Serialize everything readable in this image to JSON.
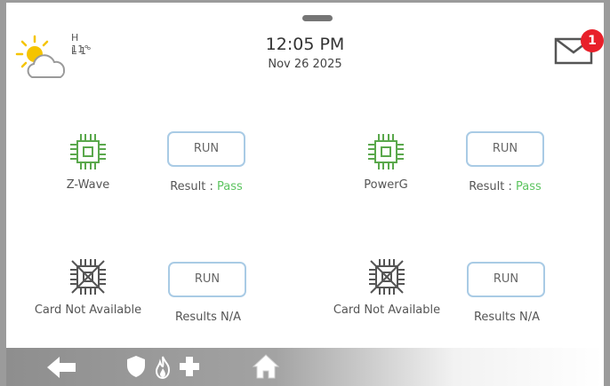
{
  "header": {
    "weather": {
      "high": "H 11°",
      "low": "L 1°",
      "icon": "partly-sunny-icon"
    },
    "time": "12:05 PM",
    "date": "Nov 26 2025",
    "messages": {
      "icon": "envelope-icon",
      "unread_count": "1"
    }
  },
  "modules": [
    {
      "name": "Z-Wave",
      "status": "available",
      "run_label": "RUN",
      "result_prefix": "Result : ",
      "result_value": "Pass"
    },
    {
      "name": "PowerG",
      "status": "available",
      "run_label": "RUN",
      "result_prefix": "Result : ",
      "result_value": "Pass"
    },
    {
      "name": "Card Not Available",
      "status": "unavailable",
      "run_label": "RUN",
      "result_text": "Results N/A"
    },
    {
      "name": "Card Not Available",
      "status": "unavailable",
      "run_label": "RUN",
      "result_text": "Results N/A"
    }
  ],
  "colors": {
    "chip_ok": "#5aa84c",
    "chip_na": "#555555",
    "pass": "#5cc45f",
    "run_border": "#a9cbe5",
    "badge": "#e8202a"
  },
  "navbar": {
    "items": [
      {
        "icon": "back-arrow-icon"
      },
      {
        "icon": "shield-icon"
      },
      {
        "icon": "fire-icon"
      },
      {
        "icon": "medical-cross-icon"
      },
      {
        "icon": "home-icon"
      }
    ]
  }
}
